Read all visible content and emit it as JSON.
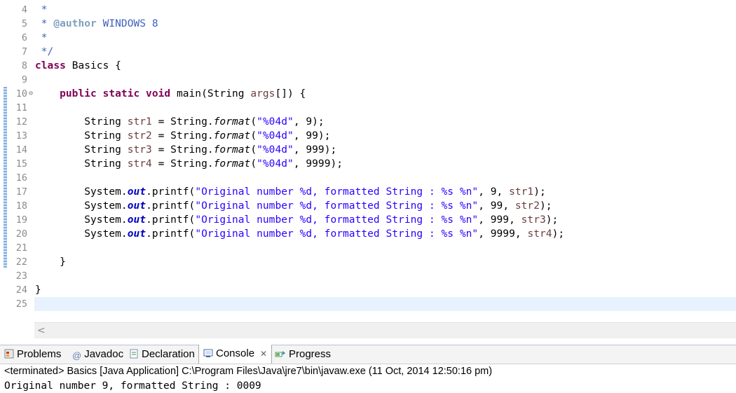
{
  "editor": {
    "line_numbers": [
      "4",
      "5",
      "6",
      "7",
      "8",
      "9",
      "10",
      "11",
      "12",
      "13",
      "14",
      "15",
      "16",
      "17",
      "18",
      "19",
      "20",
      "21",
      "22",
      "23",
      "24",
      "25"
    ],
    "comment": {
      "star": "*",
      "author_tag": "@author",
      "author_name": "WINDOWS 8",
      "close": "*/"
    },
    "class_decl": {
      "keyword": "class",
      "name": "Basics {"
    },
    "method_decl": {
      "modifiers": "public static void",
      "signature_a": "main(String ",
      "param": "args",
      "signature_b": "[]) {"
    },
    "format_lines": [
      {
        "var": "str1",
        "fmt": "\"%04d\"",
        "arg": "9);"
      },
      {
        "var": "str2",
        "fmt": "\"%04d\"",
        "arg": "99);"
      },
      {
        "var": "str3",
        "fmt": "\"%04d\"",
        "arg": "999);"
      },
      {
        "var": "str4",
        "fmt": "\"%04d\"",
        "arg": "9999);"
      }
    ],
    "print_lines": [
      {
        "fmt": "\"Original number %d, formatted String : %s %n\"",
        "num": "9",
        "var": "str1"
      },
      {
        "fmt": "\"Original number %d, formatted String : %s %n\"",
        "num": "99",
        "var": "str2"
      },
      {
        "fmt": "\"Original number %d, formatted String : %s %n\"",
        "num": "999",
        "var": "str3"
      },
      {
        "fmt": "\"Original number %d, formatted String : %s %n\"",
        "num": "9999",
        "var": "str4"
      }
    ],
    "tokens": {
      "string_type": "String ",
      "assign": " = String.",
      "format_method": "format",
      "system": "System.",
      "out": "out",
      "printf": ".printf(",
      "close_brace": "}"
    }
  },
  "console": {
    "tabs": [
      {
        "label": "Problems"
      },
      {
        "label": "Javadoc"
      },
      {
        "label": "Declaration"
      },
      {
        "label": "Console",
        "active": true
      },
      {
        "label": "Progress"
      }
    ],
    "status": "<terminated> Basics [Java Application] C:\\Program Files\\Java\\jre7\\bin\\javaw.exe (11 Oct, 2014 12:50:16 pm)",
    "output_first_line": "Original number 9, formatted String : 0009"
  },
  "colors": {
    "keyword": "#7f0055",
    "comment": "#3f5fbf",
    "string": "#2a00ff",
    "field": "#0000c0",
    "current_line": "#e8f2fe"
  }
}
